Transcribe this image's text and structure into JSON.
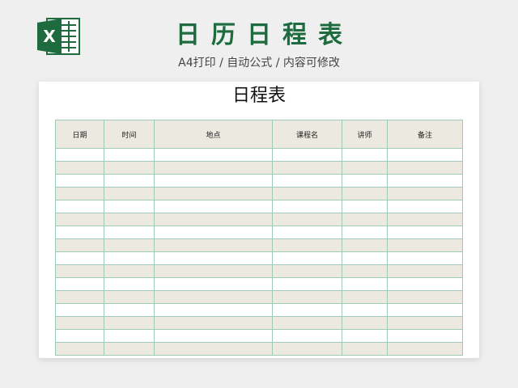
{
  "header": {
    "title": "日历日程表",
    "subtitle": "A4打印 / 自动公式 / 内容可修改",
    "logo_icon": "excel-logo-icon",
    "logo_letter": "X"
  },
  "sheet": {
    "title": "日程表",
    "columns": [
      "日期",
      "时间",
      "地点",
      "课程名",
      "讲师",
      "备注"
    ],
    "rows": [
      [
        "",
        "",
        "",
        "",
        "",
        ""
      ],
      [
        "",
        "",
        "",
        "",
        "",
        ""
      ],
      [
        "",
        "",
        "",
        "",
        "",
        ""
      ],
      [
        "",
        "",
        "",
        "",
        "",
        ""
      ],
      [
        "",
        "",
        "",
        "",
        "",
        ""
      ],
      [
        "",
        "",
        "",
        "",
        "",
        ""
      ],
      [
        "",
        "",
        "",
        "",
        "",
        ""
      ],
      [
        "",
        "",
        "",
        "",
        "",
        ""
      ],
      [
        "",
        "",
        "",
        "",
        "",
        ""
      ],
      [
        "",
        "",
        "",
        "",
        "",
        ""
      ],
      [
        "",
        "",
        "",
        "",
        "",
        ""
      ],
      [
        "",
        "",
        "",
        "",
        "",
        ""
      ],
      [
        "",
        "",
        "",
        "",
        "",
        ""
      ],
      [
        "",
        "",
        "",
        "",
        "",
        ""
      ],
      [
        "",
        "",
        "",
        "",
        "",
        ""
      ],
      [
        "",
        "",
        "",
        "",
        "",
        ""
      ]
    ]
  },
  "colors": {
    "brand_green": "#1e6b3f",
    "header_bg": "#eceae0",
    "row_even_bg": "#ffffff",
    "row_odd_bg": "#eceae0",
    "grid_line": "#9fcbb6"
  }
}
